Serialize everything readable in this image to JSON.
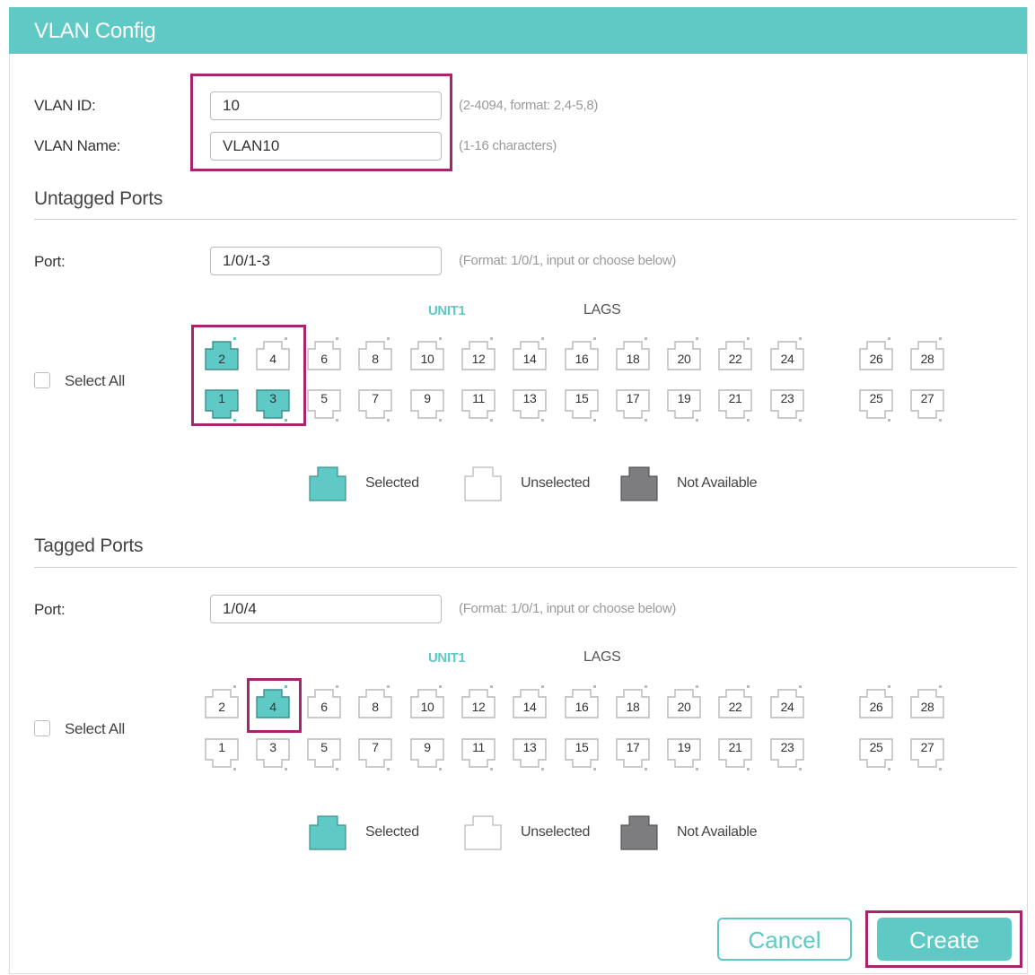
{
  "window": {
    "title": "VLAN Config"
  },
  "form": {
    "vlan_id_label": "VLAN ID:",
    "vlan_id_value": "10",
    "vlan_id_hint": "(2-4094, format: 2,4-5,8)",
    "vlan_name_label": "VLAN Name:",
    "vlan_name_value": "VLAN10",
    "vlan_name_hint": "(1-16 characters)"
  },
  "untagged": {
    "title": "Untagged Ports",
    "port_label": "Port:",
    "port_value": "1/0/1-3",
    "port_hint": "(Format: 1/0/1, input or choose below)",
    "unit_label": "UNIT1",
    "lags_label": "LAGS",
    "select_all": "Select All",
    "selected_ports": [
      "1",
      "2",
      "3"
    ]
  },
  "tagged": {
    "title": "Tagged Ports",
    "port_label": "Port:",
    "port_value": "1/0/4",
    "port_hint": "(Format: 1/0/1, input or choose below)",
    "unit_label": "UNIT1",
    "lags_label": "LAGS",
    "select_all": "Select All",
    "selected_ports": [
      "4"
    ]
  },
  "ports": {
    "top_row": [
      "2",
      "4",
      "6",
      "8",
      "10",
      "12",
      "14",
      "16",
      "18",
      "20",
      "22",
      "24",
      "26",
      "28"
    ],
    "bottom_row": [
      "1",
      "3",
      "5",
      "7",
      "9",
      "11",
      "13",
      "15",
      "17",
      "19",
      "21",
      "23",
      "25",
      "27"
    ]
  },
  "legend": {
    "selected": "Selected",
    "unselected": "Unselected",
    "not_available": "Not Available"
  },
  "buttons": {
    "cancel": "Cancel",
    "create": "Create"
  },
  "colors": {
    "accent": "#5fc9c6",
    "highlight_box": "#a6266b",
    "not_available": "#7d7d7f"
  }
}
